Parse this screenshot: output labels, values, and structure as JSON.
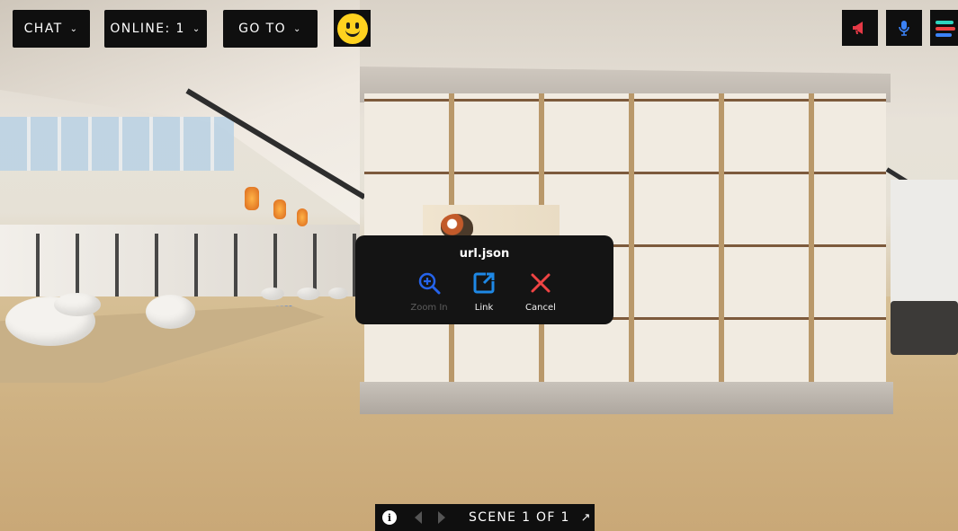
{
  "topbar": {
    "chat_label": "CHAT",
    "online_label": "ONLINE: 1",
    "goto_label": "GO TO",
    "emoji_icon": "smiley-face-icon",
    "megaphone_color": "#e63946",
    "mic_color": "#3b82f6",
    "menu_colors": [
      "#2dd4bf",
      "#ef4444",
      "#3b82f6"
    ]
  },
  "popup": {
    "title": "url.json",
    "actions": [
      {
        "label": "Zoom In",
        "icon": "zoom-in-icon",
        "color": "#2563eb",
        "enabled": false
      },
      {
        "label": "Link",
        "icon": "external-link-icon",
        "color": "#1e88e5",
        "enabled": true
      },
      {
        "label": "Cancel",
        "icon": "close-icon",
        "color": "#ef4444",
        "enabled": true
      }
    ]
  },
  "scene_nav": {
    "label": "SCENE 1 OF 1",
    "info_icon": "info-icon",
    "expand_icon": "expand-arrow-icon"
  }
}
